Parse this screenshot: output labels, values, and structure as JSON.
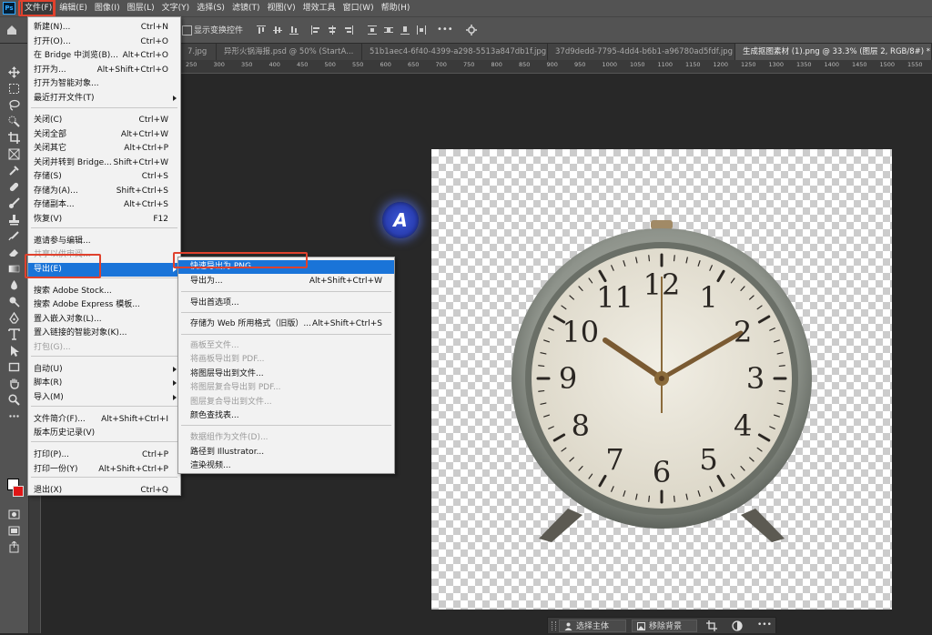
{
  "app": {
    "logo": "Ps"
  },
  "menubar": [
    "文件(F)",
    "编辑(E)",
    "图像(I)",
    "图层(L)",
    "文字(Y)",
    "选择(S)",
    "滤镜(T)",
    "视图(V)",
    "增效工具",
    "窗口(W)",
    "帮助(H)"
  ],
  "options": {
    "show_transform_label": "显示变换控件",
    "more": "•••"
  },
  "tabs": [
    "7.jpg",
    "异形火锅海报.psd @ 50% (StartA...",
    "51b1aec4-6f40-4399-a298-5513a847db1f.jpg",
    "37d9dedd-7795-4dd4-b6b1-a96780ad5fdf.jpg",
    "生成抠图素材 (1).png @ 33.3% (图层 2, RGB/8#) *"
  ],
  "ruler_labels": [
    "250",
    "300",
    "350",
    "400",
    "450",
    "500",
    "550",
    "600",
    "650",
    "700",
    "750",
    "800",
    "850",
    "900",
    "950",
    "1000",
    "1050",
    "1100",
    "1150",
    "1200",
    "1250",
    "1300",
    "1350",
    "1400",
    "1450",
    "1500",
    "1550",
    "1600"
  ],
  "file_menu": [
    {
      "label": "新建(N)...",
      "shortcut": "Ctrl+N"
    },
    {
      "label": "打开(O)...",
      "shortcut": "Ctrl+O"
    },
    {
      "label": "在 Bridge 中浏览(B)...",
      "shortcut": "Alt+Ctrl+O"
    },
    {
      "label": "打开为...",
      "shortcut": "Alt+Shift+Ctrl+O"
    },
    {
      "label": "打开为智能对象...",
      "shortcut": ""
    },
    {
      "label": "最近打开文件(T)",
      "shortcut": ""
    },
    {
      "label": "关闭(C)",
      "shortcut": "Ctrl+W"
    },
    {
      "label": "关闭全部",
      "shortcut": "Alt+Ctrl+W"
    },
    {
      "label": "关闭其它",
      "shortcut": "Alt+Ctrl+P"
    },
    {
      "label": "关闭并转到 Bridge...",
      "shortcut": "Shift+Ctrl+W"
    },
    {
      "label": "存储(S)",
      "shortcut": "Ctrl+S"
    },
    {
      "label": "存储为(A)...",
      "shortcut": "Shift+Ctrl+S"
    },
    {
      "label": "存储副本...",
      "shortcut": "Alt+Ctrl+S"
    },
    {
      "label": "恢复(V)",
      "shortcut": "F12"
    },
    {
      "label": "邀请参与编辑...",
      "shortcut": ""
    },
    {
      "label": "共享以供审阅...",
      "shortcut": ""
    },
    {
      "label": "导出(E)",
      "shortcut": ""
    },
    {
      "label": "搜索 Adobe Stock...",
      "shortcut": ""
    },
    {
      "label": "搜索 Adobe Express 模板...",
      "shortcut": ""
    },
    {
      "label": "置入嵌入对象(L)...",
      "shortcut": ""
    },
    {
      "label": "置入链接的智能对象(K)...",
      "shortcut": ""
    },
    {
      "label": "打包(G)...",
      "shortcut": ""
    },
    {
      "label": "自动(U)",
      "shortcut": ""
    },
    {
      "label": "脚本(R)",
      "shortcut": ""
    },
    {
      "label": "导入(M)",
      "shortcut": ""
    },
    {
      "label": "文件简介(F)...",
      "shortcut": "Alt+Shift+Ctrl+I"
    },
    {
      "label": "版本历史记录(V)",
      "shortcut": ""
    },
    {
      "label": "打印(P)...",
      "shortcut": "Ctrl+P"
    },
    {
      "label": "打印一份(Y)",
      "shortcut": "Alt+Shift+Ctrl+P"
    },
    {
      "label": "退出(X)",
      "shortcut": "Ctrl+Q"
    }
  ],
  "export_menu": [
    {
      "label": "快速导出为 PNG",
      "shortcut": ""
    },
    {
      "label": "导出为...",
      "shortcut": "Alt+Shift+Ctrl+W"
    },
    {
      "label": "导出首选项...",
      "shortcut": ""
    },
    {
      "label": "存储为 Web 所用格式（旧版）...",
      "shortcut": "Alt+Shift+Ctrl+S"
    },
    {
      "label": "画板至文件...",
      "shortcut": ""
    },
    {
      "label": "将画板导出到 PDF...",
      "shortcut": ""
    },
    {
      "label": "将图层导出到文件...",
      "shortcut": ""
    },
    {
      "label": "将图层复合导出到 PDF...",
      "shortcut": ""
    },
    {
      "label": "图层复合导出到文件...",
      "shortcut": ""
    },
    {
      "label": "颜色查找表...",
      "shortcut": ""
    },
    {
      "label": "数据组作为文件(D)...",
      "shortcut": ""
    },
    {
      "label": "路径到 Illustrator...",
      "shortcut": ""
    },
    {
      "label": "渲染视频...",
      "shortcut": ""
    }
  ],
  "clock_numbers": [
    "12",
    "1",
    "2",
    "3",
    "4",
    "5",
    "6",
    "7",
    "8",
    "9",
    "10",
    "11"
  ],
  "badge": {
    "letter": "A"
  },
  "taskbar": {
    "select_subject": "选择主体",
    "remove_bg": "移除背景"
  },
  "colors": {
    "highlight": "#1a74d8",
    "annotation": "#e0412d",
    "panel": "#535353",
    "workspace": "#282828"
  }
}
